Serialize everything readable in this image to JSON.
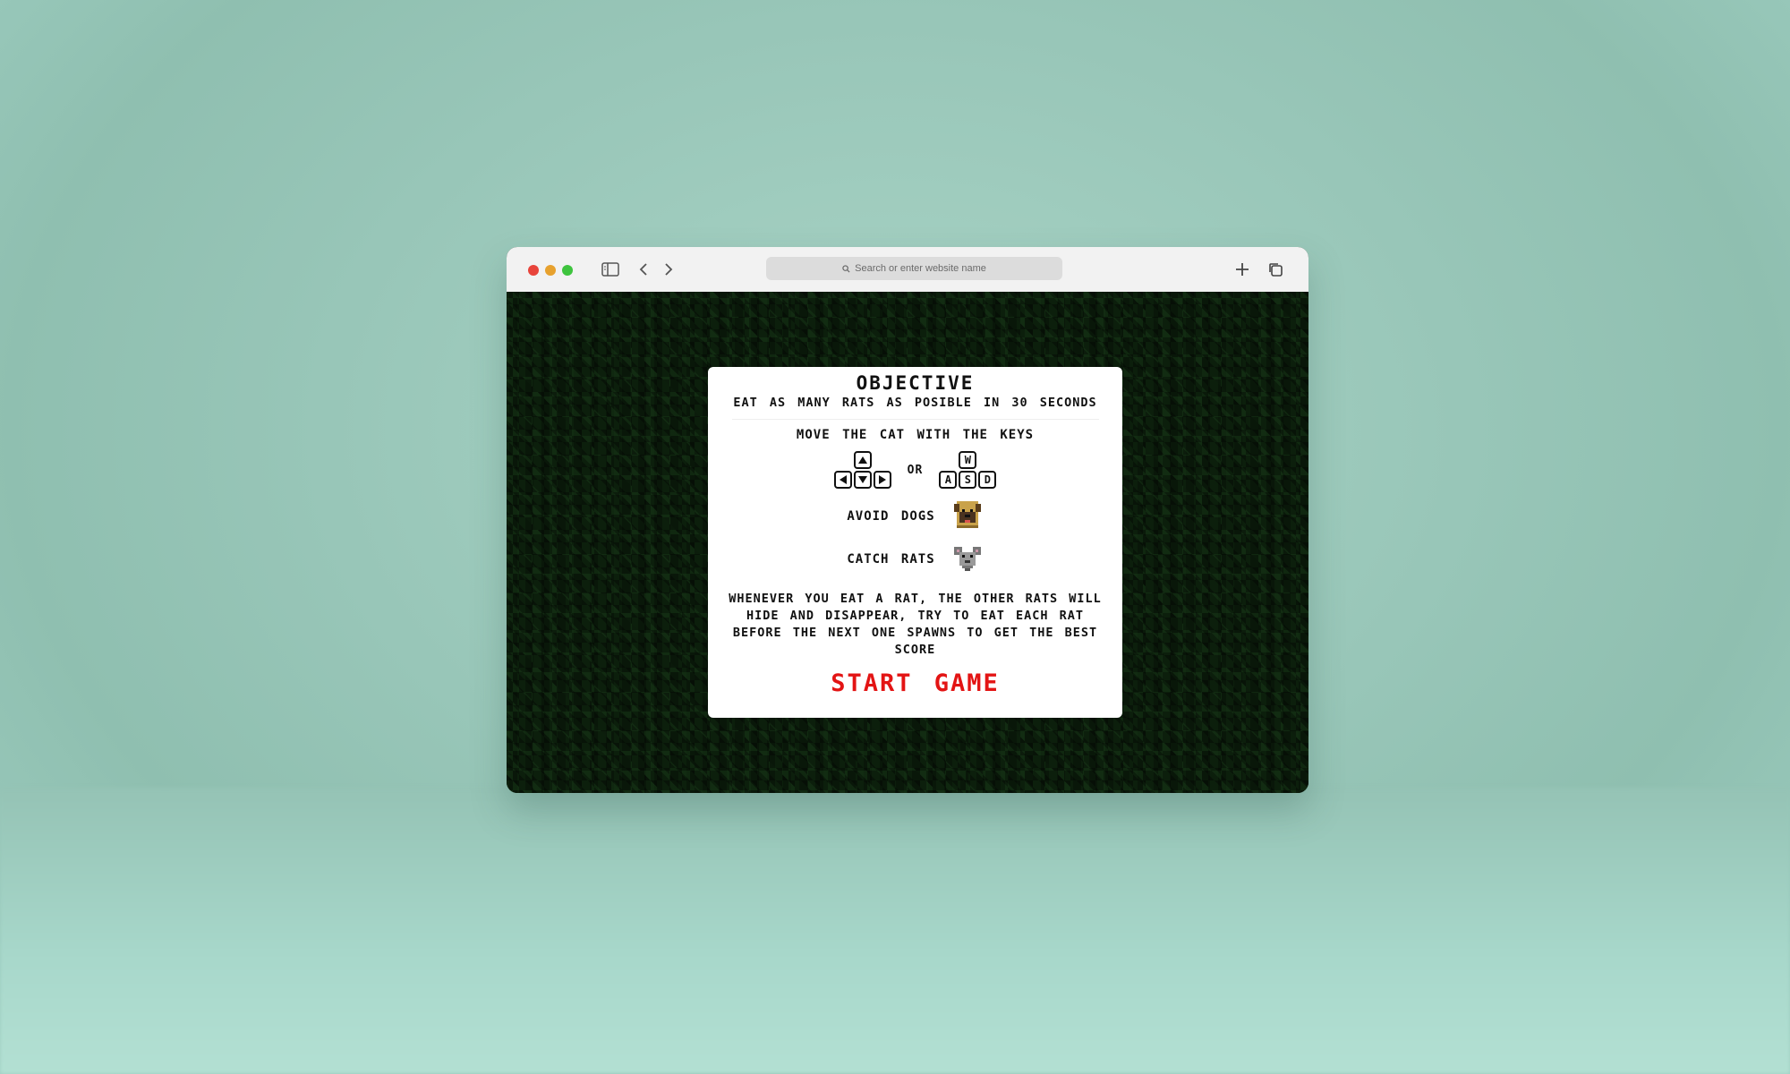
{
  "browser": {
    "address_placeholder": "Search or enter website name"
  },
  "card": {
    "title": "OBJECTIVE",
    "subtitle": "EAT AS MANY RATS AS POSIBLE IN 30 SECONDS",
    "move_label": "MOVE THE CAT WITH THE KEYS",
    "or_label": "OR",
    "wasd": [
      "W",
      "A",
      "S",
      "D"
    ],
    "avoid_label": "AVOID DOGS",
    "catch_label": "CATCH RATS",
    "paragraph": "WHENEVER YOU EAT A RAT, THE OTHER RATS WILL HIDE AND DISAPPEAR, TRY TO EAT EACH RAT BEFORE THE NEXT ONE SPAWNS TO GET THE BEST SCORE",
    "start_label": "START GAME"
  },
  "icons": {
    "traffic_lights": [
      "close-icon",
      "minimize-icon",
      "maximize-icon"
    ],
    "toolbar": [
      "sidebar-icon",
      "back-icon",
      "forward-icon",
      "search-icon",
      "new-tab-icon",
      "tabs-overview-icon"
    ],
    "arrow_keys": [
      "arrow-up-icon",
      "arrow-left-icon",
      "arrow-down-icon",
      "arrow-right-icon"
    ],
    "sprites": [
      "dog-icon",
      "rat-icon"
    ]
  },
  "colors": {
    "start_button": "#e31414",
    "game_background": "#0c1f0c",
    "card_background": "#ffffff"
  }
}
